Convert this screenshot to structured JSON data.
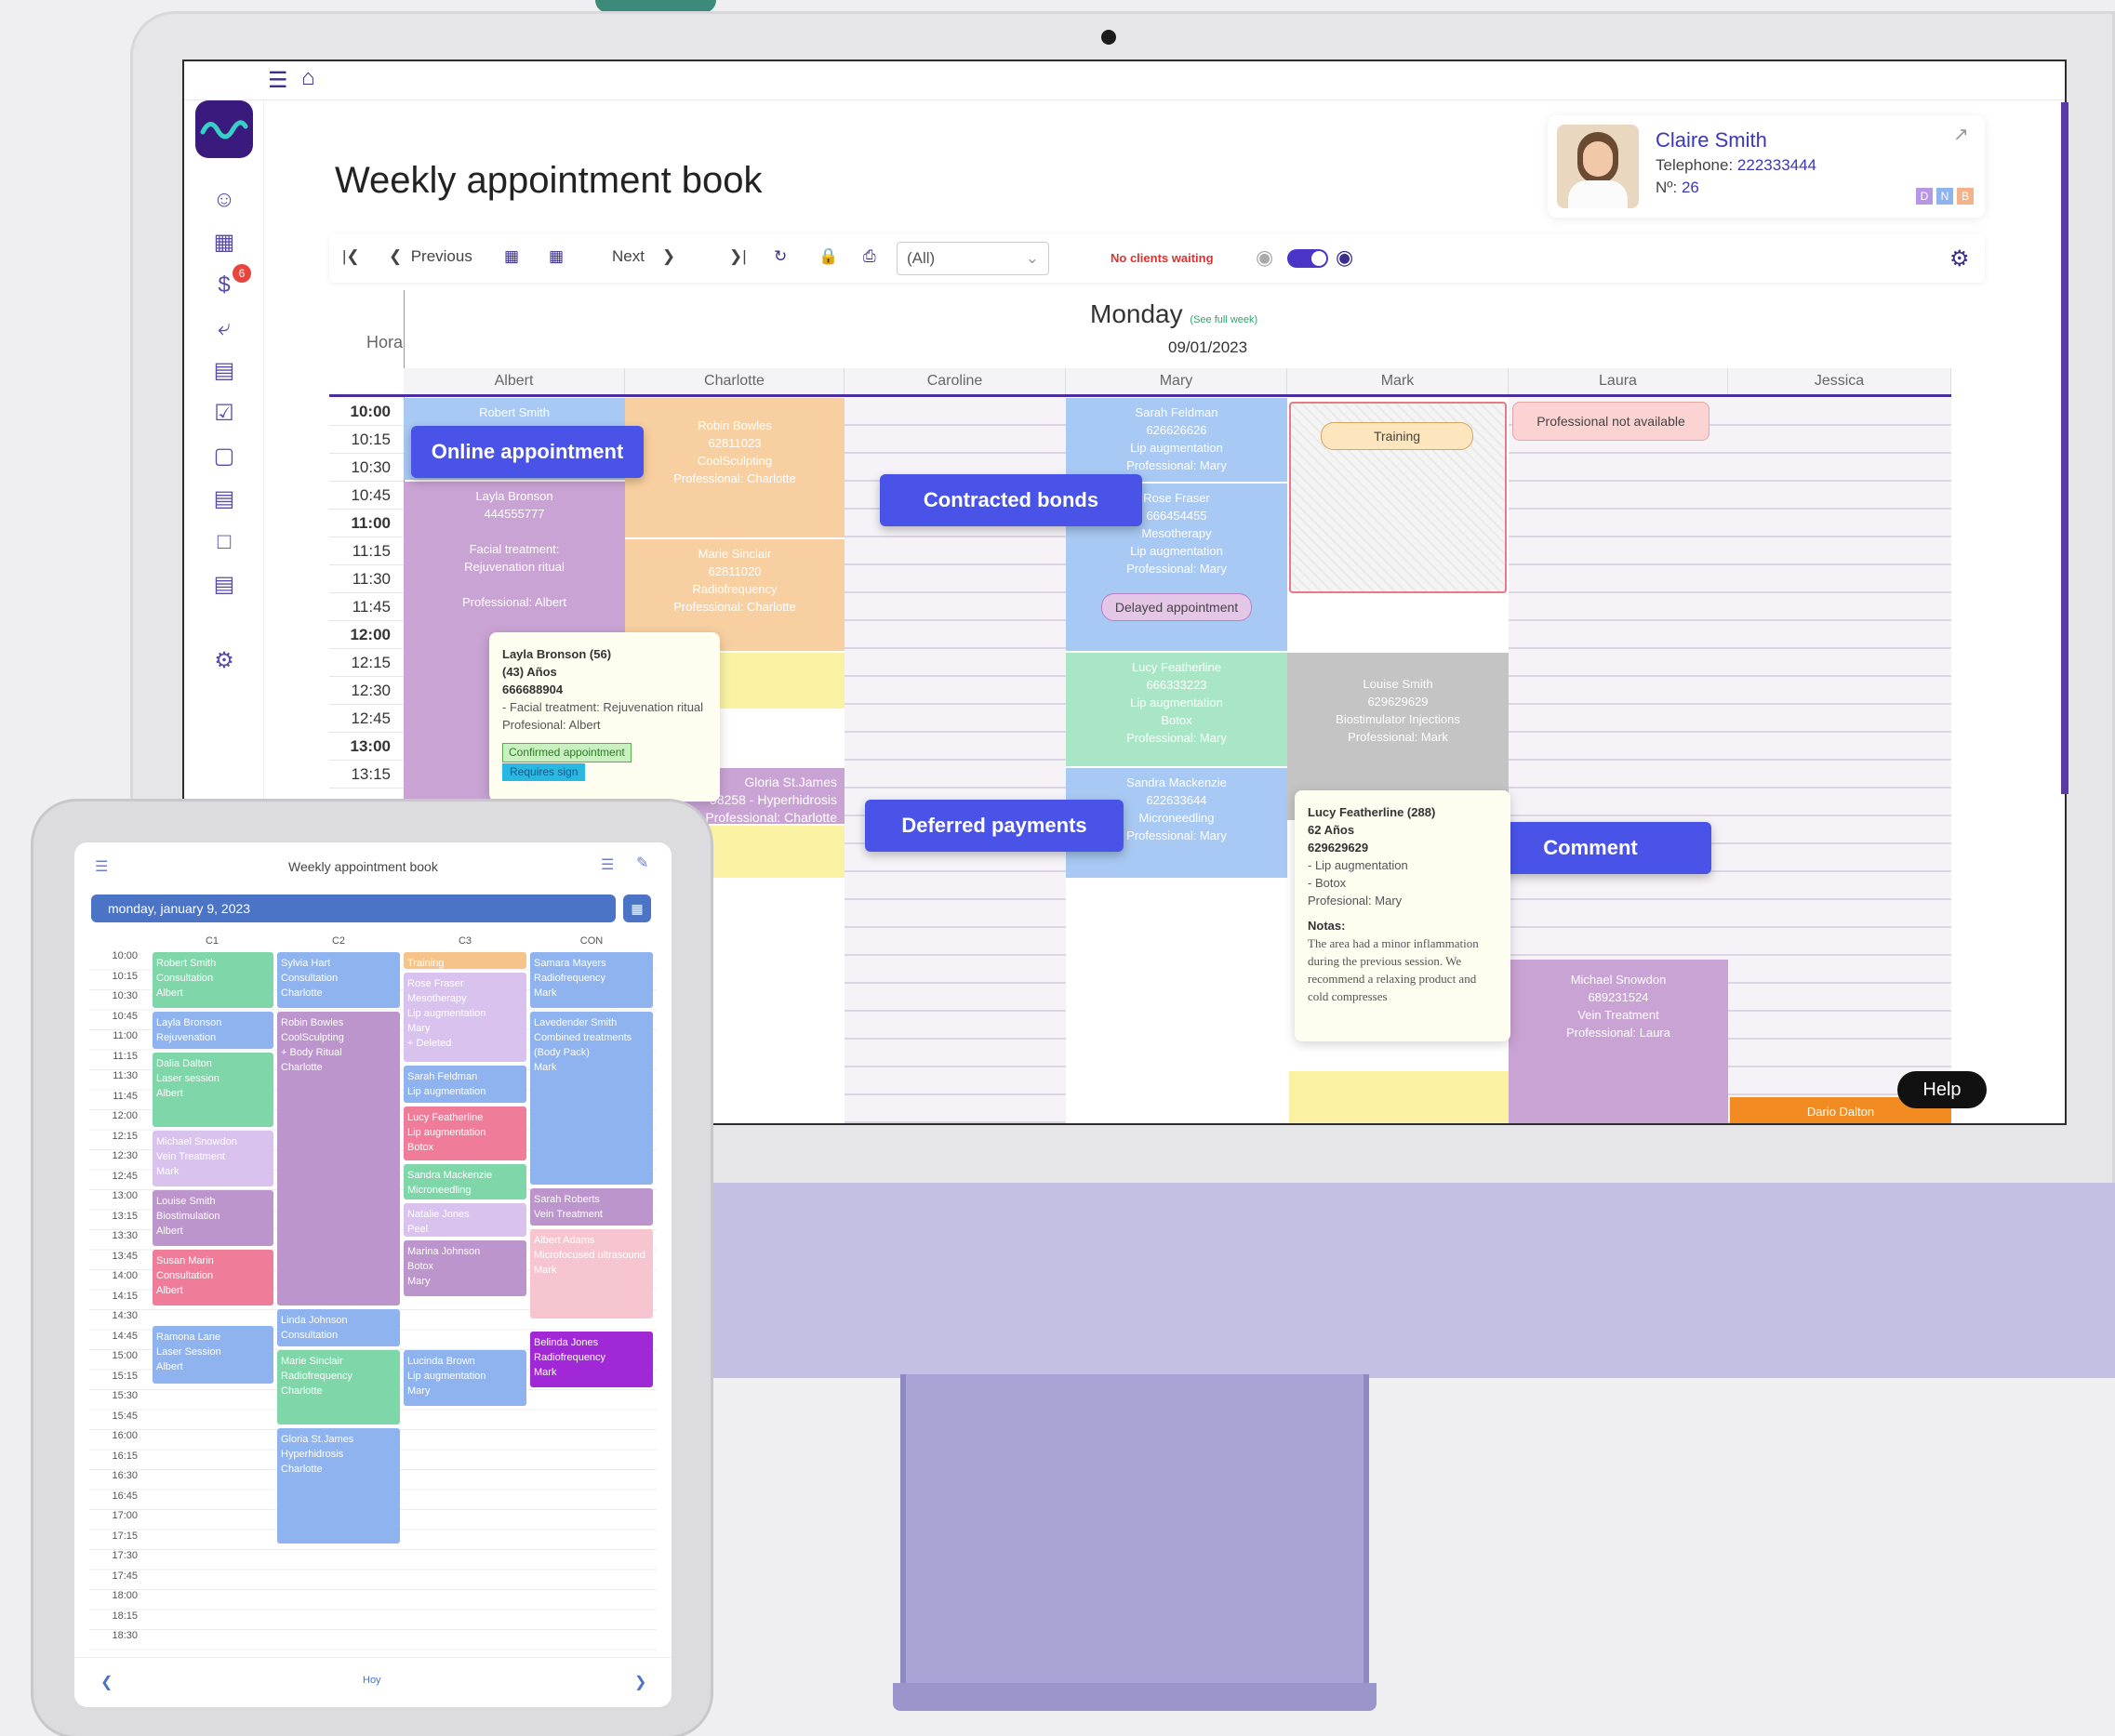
{
  "app": {
    "title": "Weekly appointment book"
  },
  "patient": {
    "name": "Claire Smith",
    "phone_label": "Telephone:",
    "phone": "222333444",
    "number_label": "Nº:",
    "number": "26",
    "tags": [
      "D",
      "N",
      "B"
    ]
  },
  "sidebar": {
    "badge": "6"
  },
  "toolbar": {
    "previous": "Previous",
    "next": "Next",
    "filter": "(All)",
    "waiting": "No clients waiting"
  },
  "calendar": {
    "day": "Monday",
    "see_full_week": "(See full week)",
    "date": "09/01/2023",
    "hour_label": "Hora",
    "columns": [
      "Albert",
      "Charlotte",
      "Caroline",
      "Mary",
      "Mark",
      "Laura",
      "Jessica"
    ],
    "times": [
      "10:00",
      "10:15",
      "10:30",
      "10:45",
      "11:00",
      "11:15",
      "11:30",
      "11:45",
      "12:00",
      "12:15",
      "12:30",
      "12:45",
      "13:00",
      "13:15"
    ]
  },
  "appointments": {
    "robert": "Robert Smith",
    "layla": "Layla Bronson\n444555777\n\nFacial treatment:\nRejuvenation ritual\n\nProfessional: Albert",
    "robin": "Robin Bowles\n62811023\nCoolSculpting\nProfessional: Charlotte",
    "marie": "Marie Sinclair\n62811020\nRadiofrequency\nProfessional: Charlotte",
    "gloria": "Gloria St.James\n58258 - Hyperhidrosis\nProfessional: Charlotte",
    "sarah": "Sarah Feldman\n626626626\nLip augmentation\nProfessional: Mary",
    "rose": "Rose Fraser\n666454455\nMesotherapy\nLip augmentation\nProfessional: Mary",
    "lucy": "Lucy Featherline\n666333223\nLip augmentation\nBotox\nProfessional: Mary",
    "sandra": "Sandra Mackenzie\n622633644\nMicroneedling\nProfessional: Mary",
    "louise": "Louise Smith\n629629629\nBiostimulator Injections\nProfessional: Mark",
    "michael": "Michael Snowdon\n689231524\nVein Treatment\nProfessional: Laura",
    "dario": "Dario Dalton",
    "training": "Training",
    "not_available": "Professional not available",
    "delayed": "Delayed appointment"
  },
  "callouts": {
    "online": "Online appointment",
    "bonds": "Contracted bonds",
    "deferred": "Deferred payments",
    "comment": "Comment",
    "help": "Help"
  },
  "tooltip1": {
    "name": "Layla Bronson (56)",
    "age": "(43) Años",
    "phone": "666688904",
    "treatment": "- Facial treatment: Rejuvenation ritual",
    "professional": "Profesional: Albert",
    "confirmed": "Confirmed appointment",
    "sign": "Requires sign"
  },
  "tooltip2": {
    "name": "Lucy Featherline (288)",
    "age": "62 Años",
    "phone": "629629629",
    "t1": "- Lip augmentation",
    "t2": "- Botox",
    "professional": "Profesional: Mary",
    "notes_label": "Notas:",
    "notes": "The area had a minor inflammation during the previous session. We recommend a relaxing product and cold compresses"
  },
  "tablet": {
    "title": "Weekly appointment book",
    "date": "monday, january 9, 2023",
    "today": "Hoy",
    "columns": [
      "C1",
      "C2",
      "C3",
      "CON"
    ],
    "times": [
      "10:00",
      "10:15",
      "10:30",
      "10:45",
      "11:00",
      "11:15",
      "11:30",
      "11:45",
      "12:00",
      "12:15",
      "12:30",
      "12:45",
      "13:00",
      "13:15",
      "13:30",
      "13:45",
      "14:00",
      "14:15",
      "14:30",
      "14:45",
      "15:00",
      "15:15",
      "15:30",
      "15:45",
      "16:00",
      "16:15",
      "16:30",
      "16:45",
      "17:00",
      "17:15",
      "17:30",
      "17:45",
      "18:00",
      "18:15",
      "18:30"
    ],
    "appts": {
      "a1": "Robert Smith\nConsultation\nAlbert",
      "a2": "Layla Bronson\nRejuvenation",
      "a3": "Dalia Dalton\nLaser session\nAlbert",
      "a4": "Michael Snowdon\nVein Treatment\nMark",
      "a5": "Louise Smith\nBiostimulation\nAlbert",
      "a6": "Susan Marin\nConsultation\nAlbert",
      "a7": "Ramona Lane\nLaser Session\nAlbert",
      "b1": "Sylvia Hart\nConsultation\nCharlotte",
      "b2": "Robin Bowles\nCoolSculpting\n+ Body Ritual\nCharlotte",
      "b3": "Linda Johnson\nConsultation",
      "b4": "Marie Sinclair\nRadiofrequency\nCharlotte",
      "b5": "Gloria St.James\nHyperhidrosis\nCharlotte",
      "c0": "Training",
      "c1": "Rose Fraser\nMesotherapy\nLip augmentation\nMary\n+ Deleted",
      "c2": "Sarah Feldman\nLip augmentation",
      "c3": "Lucy Featherline\nLip augmentation\nBotox",
      "c4": "Sandra Mackenzie\nMicroneedling",
      "c5": "Natalie Jones\nPeel",
      "c6": "Marina Johnson\nBotox\nMary",
      "c7": "Lucinda Brown\nLip augmentation\nMary",
      "d1": "Samara Mayers\nRadiofrequency\nMark",
      "d2": "Lavedender Smith\nCombined treatments\n(Body Pack)\nMark",
      "d3": "Sarah Roberts\nVein Treatment",
      "d4": "Albert Adams\nMicrofocused ultrasound\nMark",
      "d5": "Belinda Jones\nRadiofrequency\nMark"
    }
  }
}
